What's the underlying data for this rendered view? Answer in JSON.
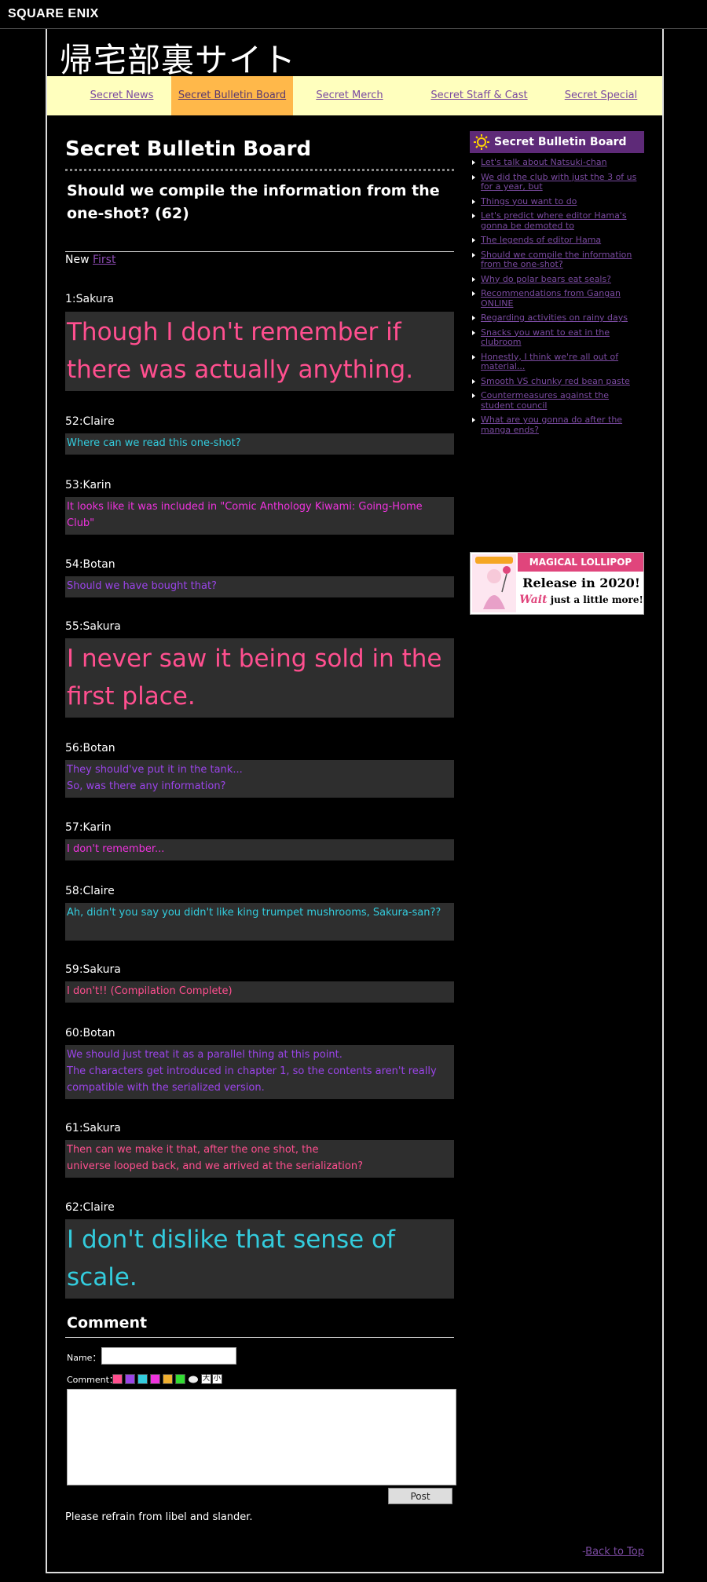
{
  "header": {
    "brand": "SQUARE ENIX",
    "site_title": "帰宅部裏サイト"
  },
  "nav": [
    {
      "label": "Secret News"
    },
    {
      "label": "Secret Bulletin Board"
    },
    {
      "label": "Secret Merch"
    },
    {
      "label": "Secret Staff & Cast"
    },
    {
      "label": "Secret Special"
    }
  ],
  "main": {
    "page_title": "Secret Bulletin Board",
    "thread_title": "Should we compile the information from the one-shot? (62)",
    "new_label": "New",
    "first_link": "First",
    "posts": [
      {
        "author": "1:Sakura",
        "text": "Though I don't remember if there was actually anything.",
        "color": "#ff4f8f",
        "size": "big"
      },
      {
        "author": "52:Claire",
        "text": "Where can we read this one-shot?",
        "color": "#33ccdd",
        "size": "small"
      },
      {
        "author": "53:Karin",
        "text": "It looks like it was included in \"Comic Anthology Kiwami: Going-Home Club\"",
        "color": "#ee33dd",
        "size": "small"
      },
      {
        "author": "54:Botan",
        "text": "Should we have bought that?",
        "color": "#9a44e8",
        "size": "small"
      },
      {
        "author": "55:Sakura",
        "text": "I never saw it being sold in the first place.",
        "color": "#ff4f8f",
        "size": "big"
      },
      {
        "author": "56:Botan",
        "text": "They should've put it in the tank...\nSo, was there any information?",
        "color": "#9a44e8",
        "size": "small"
      },
      {
        "author": "57:Karin",
        "text": "I don't remember...",
        "color": "#ee33dd",
        "size": "small"
      },
      {
        "author": "58:Claire",
        "text": "Ah, didn't you say you didn't like king trumpet mushrooms, Sakura-san??",
        "color": "#33ccdd",
        "size": "small"
      },
      {
        "author": "59:Sakura",
        "text": "I don't!! (Compilation Complete)",
        "color": "#ff4f8f",
        "size": "small"
      },
      {
        "author": "60:Botan",
        "text": "We should just treat it as a parallel thing at this point.\nThe characters get introduced in chapter 1, so the contents aren't really compatible with the serialized version.",
        "color": "#9a44e8",
        "size": "small"
      },
      {
        "author": "61:Sakura",
        "text": "Then can we make it that, after the one shot, the\nuniverse looped back, and we arrived at the serialization?",
        "color": "#ff4f8f",
        "size": "small"
      },
      {
        "author": "62:Claire",
        "text": "I don't dislike that sense of scale.",
        "color": "#33ccdd",
        "size": "big"
      }
    ]
  },
  "comment": {
    "heading": "Comment",
    "name_label": "Name：",
    "comment_label": "Comment：",
    "swatches": [
      "#ff4f8f",
      "#9a44e8",
      "#33ccdd",
      "#ee33dd",
      "#f0b030",
      "#33dd33"
    ],
    "size_large": "大",
    "size_small": "小",
    "post_button": "Post",
    "note": "Please refrain from libel and slander."
  },
  "sidebar": {
    "heading": "Secret Bulletin Board",
    "links": [
      "Let's talk about Natsuki-chan",
      "We did the club with just the 3 of us for a year, but",
      "Things you want to do",
      "Let's predict where editor Hama's gonna be demoted to",
      "The legends of editor Hama",
      "Should we compile the information from the one-shot?",
      "Why do polar bears eat seals?",
      "Recommendations from Gangan ONLINE",
      "Regarding activities on rainy days",
      "Snacks you want to eat in the clubroom",
      "Honestly, I think we're all out of material...",
      "Smooth VS chunky red bean paste",
      "Countermeasures against the student council",
      "What are you gonna do after the manga ends?"
    ],
    "banner": {
      "title": "MAGICAL LOLLIPOP",
      "release": "Release in 2020!",
      "wait_word": "Wait",
      "wait_rest": " just a little more!"
    }
  },
  "footer": {
    "back_prefix": "-",
    "back_link": "Back to Top"
  }
}
